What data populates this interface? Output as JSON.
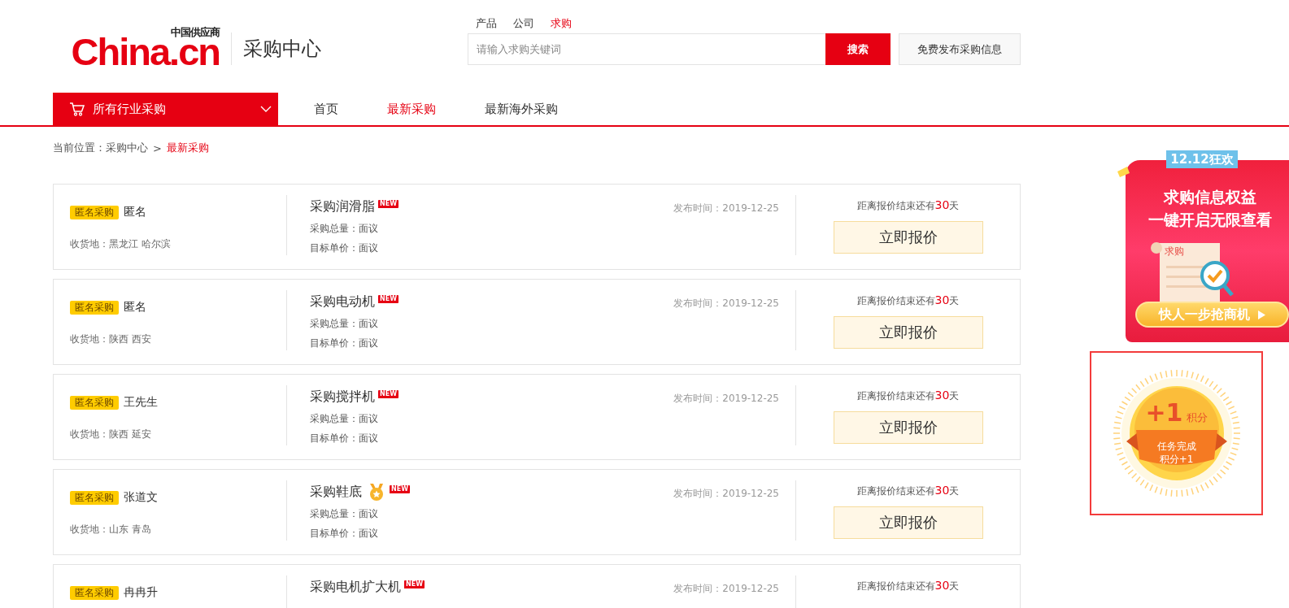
{
  "logo": {
    "brand": "China.cn",
    "tagline": "中国供应商"
  },
  "site_section": "采购中心",
  "search_tabs": [
    {
      "label": "产品",
      "selected": false
    },
    {
      "label": "公司",
      "selected": false
    },
    {
      "label": "求购",
      "selected": true
    }
  ],
  "search": {
    "placeholder": "请输入求购关键词",
    "button": "搜索"
  },
  "publish_button": "免费发布采购信息",
  "category_menu": {
    "label": "所有行业采购"
  },
  "nav": [
    {
      "label": "首页",
      "selected": false
    },
    {
      "label": "最新采购",
      "selected": true
    },
    {
      "label": "最新海外采购",
      "selected": false
    }
  ],
  "breadcrumb": {
    "prefix": "当前位置：",
    "separator": ">",
    "items": [
      {
        "label": "采购中心",
        "current": false
      },
      {
        "label": "最新采购",
        "current": true
      }
    ]
  },
  "listings": [
    {
      "tag": "匿名采购",
      "buyer": "匿名",
      "location": "收货地：黑龙江 哈尔滨",
      "title": "采购润滑脂",
      "medal": false,
      "badge": "NEW",
      "volume": "采购总量：面议",
      "price": "目标单价：面议",
      "published": "发布时间：2019-12-25",
      "deadline_prefix": "距离报价结束还有",
      "deadline_days": "30",
      "deadline_suffix": "天",
      "button": "立即报价"
    },
    {
      "tag": "匿名采购",
      "buyer": "匿名",
      "location": "收货地：陕西 西安",
      "title": "采购电动机",
      "medal": false,
      "badge": "NEW",
      "volume": "采购总量：面议",
      "price": "目标单价：面议",
      "published": "发布时间：2019-12-25",
      "deadline_prefix": "距离报价结束还有",
      "deadline_days": "30",
      "deadline_suffix": "天",
      "button": "立即报价"
    },
    {
      "tag": "匿名采购",
      "buyer": "王先生",
      "location": "收货地：陕西 延安",
      "title": "采购搅拌机",
      "medal": false,
      "badge": "NEW",
      "volume": "采购总量：面议",
      "price": "目标单价：面议",
      "published": "发布时间：2019-12-25",
      "deadline_prefix": "距离报价结束还有",
      "deadline_days": "30",
      "deadline_suffix": "天",
      "button": "立即报价"
    },
    {
      "tag": "匿名采购",
      "buyer": "张道文",
      "location": "收货地：山东 青岛",
      "title": "采购鞋底",
      "medal": true,
      "badge": "NEW",
      "volume": "采购总量：面议",
      "price": "目标单价：面议",
      "published": "发布时间：2019-12-25",
      "deadline_prefix": "距离报价结束还有",
      "deadline_days": "30",
      "deadline_suffix": "天",
      "button": "立即报价"
    },
    {
      "tag": "匿名采购",
      "buyer": "冉冉升",
      "title": "采购电机扩大机",
      "medal": false,
      "badge": "NEW",
      "published": "发布时间：2019-12-25",
      "deadline_prefix": "距离报价结束还有",
      "deadline_days": "30",
      "deadline_suffix": "天"
    }
  ],
  "promo": {
    "ribbon": "12.12狂欢",
    "headline": [
      "求购信息权益",
      "一键开启无限查看"
    ],
    "scroll_label": "求购",
    "button": "快人一步抢商机"
  },
  "task_badge": {
    "points": "+1",
    "unit": "积分",
    "ribbon_lines": [
      "任务完成",
      "积分+1"
    ]
  }
}
